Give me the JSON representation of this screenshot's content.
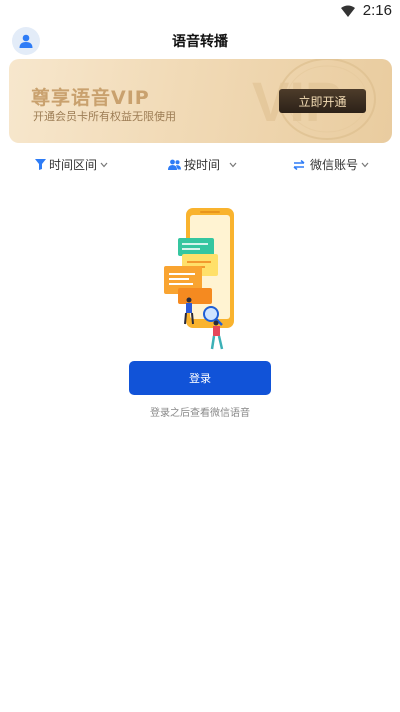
{
  "status_bar": {
    "time": "2:16",
    "icons": [
      "wifi-icon"
    ]
  },
  "header": {
    "title": "语音转播",
    "avatar_icon": "user-icon"
  },
  "vip_banner": {
    "title": "尊享语音VIP",
    "subtitle": "开通会员卡所有权益无限使用",
    "button_label": "立即开通",
    "watermark_text": "VIP"
  },
  "filters": [
    {
      "label": "时间区间",
      "icon": "funnel-icon"
    },
    {
      "label": "按时间",
      "icon": "users-icon"
    },
    {
      "label": "微信账号",
      "icon": "swap-icon"
    }
  ],
  "login": {
    "button_label": "登录",
    "hint": "登录之后查看微信语音"
  },
  "colors": {
    "accent": "#1153d8",
    "vip_gold": "#c9a16e",
    "icon_blue": "#2e7cf6"
  }
}
